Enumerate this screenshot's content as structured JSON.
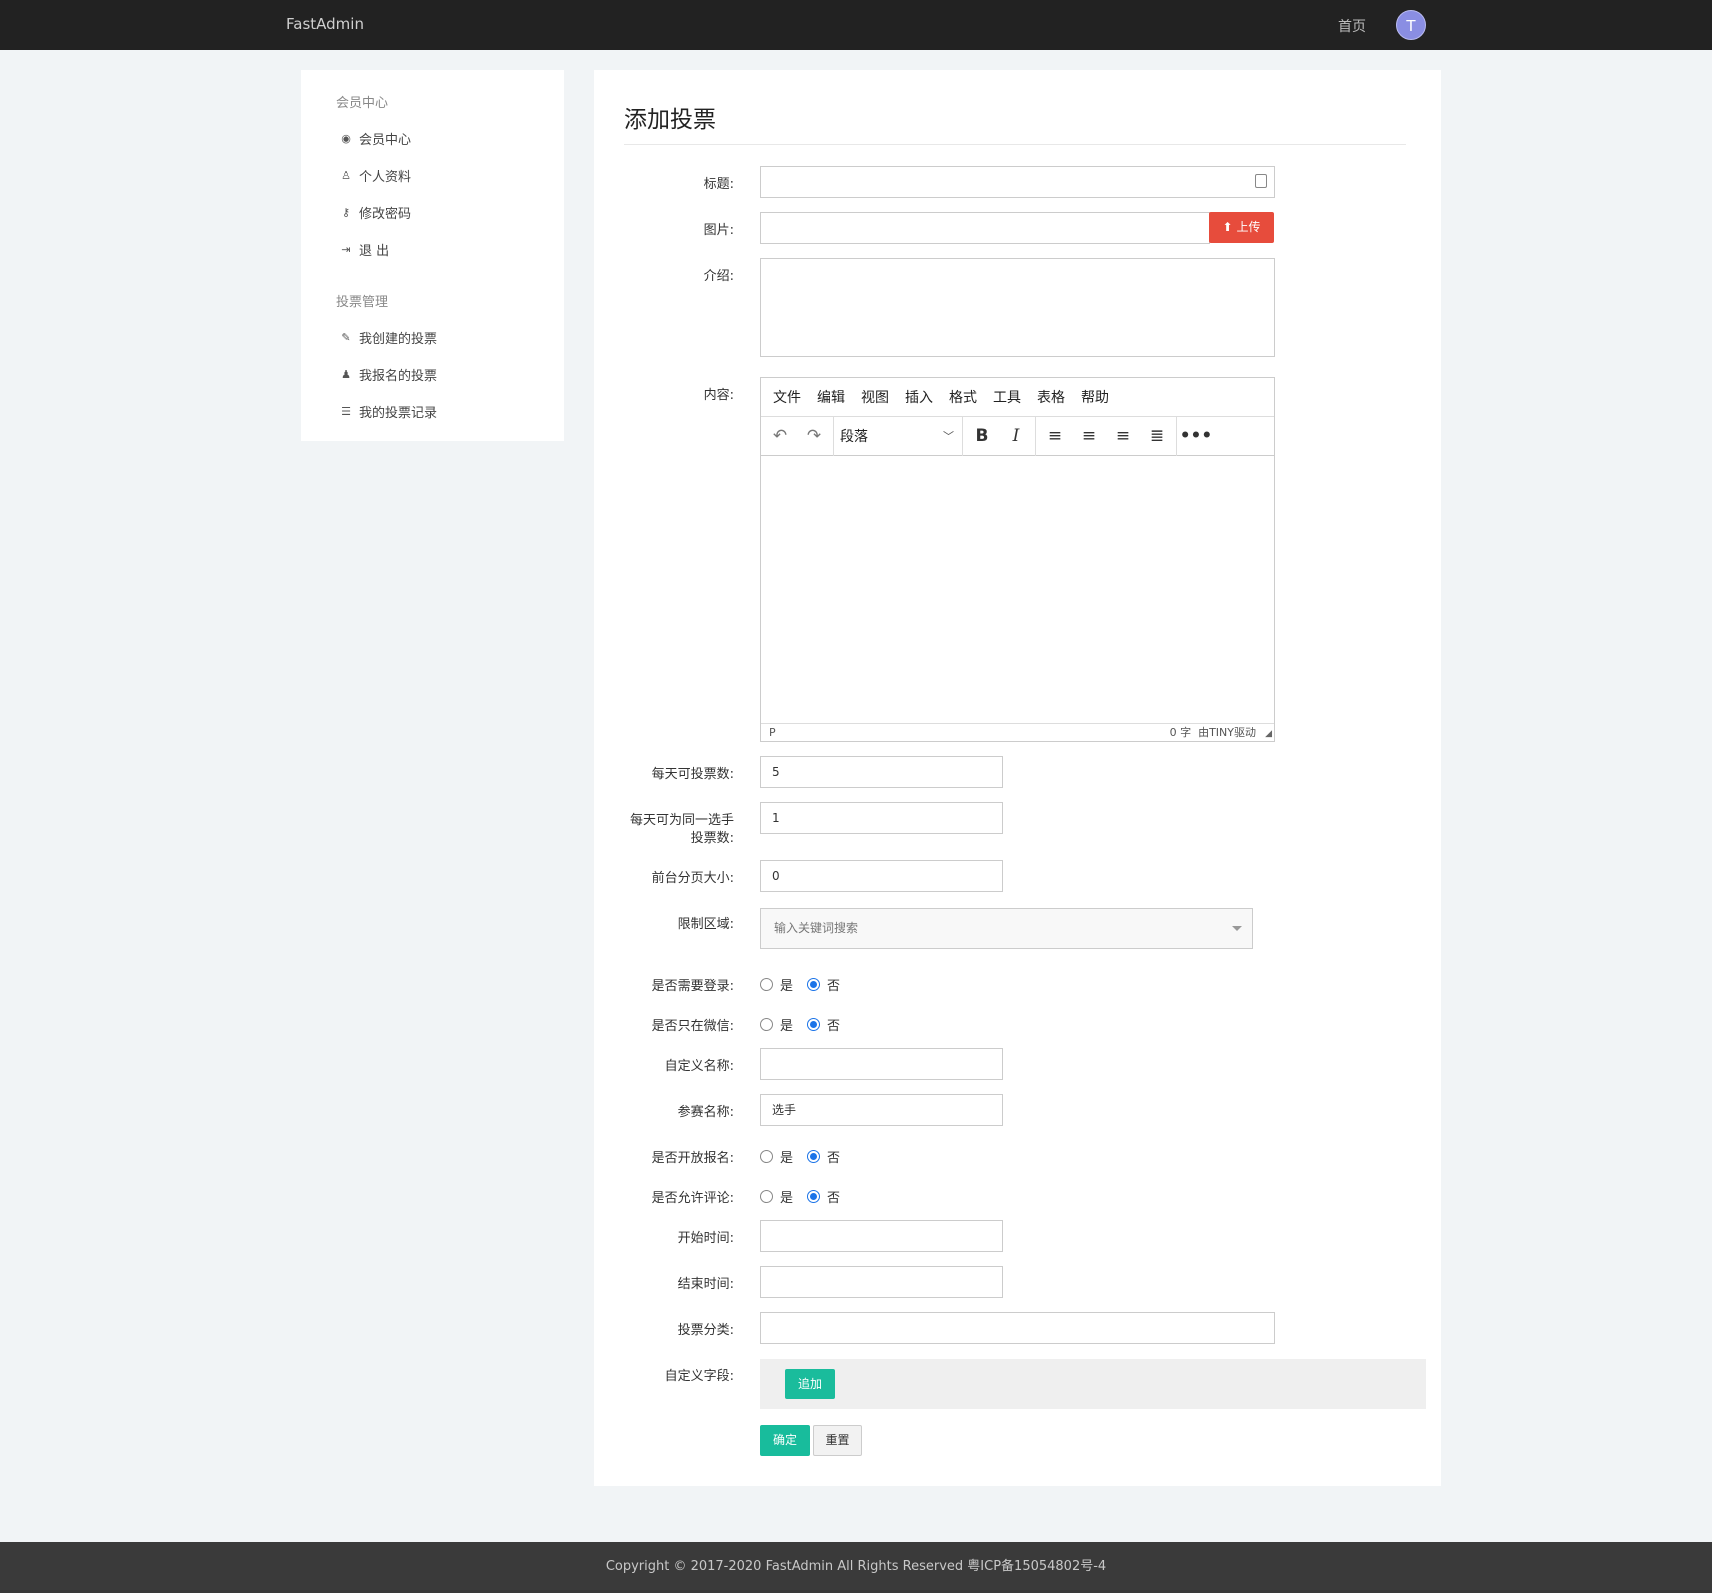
{
  "topbar": {
    "brand": "FastAdmin",
    "home_link": "首页",
    "avatar_letter": "T"
  },
  "sidebar": {
    "section1_title": "会员中心",
    "section1_items": [
      {
        "icon": "user-circle-icon",
        "glyph": "◉",
        "label": "会员中心"
      },
      {
        "icon": "user-icon",
        "glyph": "♙",
        "label": "个人资料"
      },
      {
        "icon": "key-icon",
        "glyph": "⚷",
        "label": "修改密码"
      },
      {
        "icon": "sign-out-icon",
        "glyph": "⇥",
        "label": "退 出"
      }
    ],
    "section2_title": "投票管理",
    "section2_items": [
      {
        "icon": "pencil-icon",
        "glyph": "✎",
        "label": "我创建的投票"
      },
      {
        "icon": "users-icon",
        "glyph": "♟",
        "label": "我报名的投票"
      },
      {
        "icon": "list-icon",
        "glyph": "☰",
        "label": "我的投票记录"
      }
    ]
  },
  "form": {
    "page_title": "添加投票",
    "labels": {
      "title": "标题:",
      "image": "图片:",
      "intro": "介绍:",
      "content": "内容:",
      "daily_votes": "每天可投票数:",
      "daily_same_line1": "每天可为同一选手",
      "daily_same_line2": "投票数:",
      "page_size": "前台分页大小:",
      "region": "限制区域:",
      "need_login": "是否需要登录:",
      "wechat_only": "是否只在微信:",
      "custom_name": "自定义名称:",
      "contestant_name": "参赛名称:",
      "open_signup": "是否开放报名:",
      "allow_comment": "是否允许评论:",
      "start_time": "开始时间:",
      "end_time": "结束时间:",
      "category": "投票分类:",
      "custom_fields": "自定义字段:"
    },
    "values": {
      "title": "",
      "image": "",
      "daily_votes": "5",
      "daily_same": "1",
      "page_size": "0",
      "custom_name": "",
      "contestant_name": "选手",
      "start_time": "",
      "end_time": "",
      "category": ""
    },
    "region_placeholder": "输入关键词搜索",
    "upload_label": "上传",
    "radio_yes": "是",
    "radio_no": "否",
    "add_label": "追加",
    "submit_label": "确定",
    "reset_label": "重置"
  },
  "editor": {
    "menus": [
      "文件",
      "编辑",
      "视图",
      "插入",
      "格式",
      "工具",
      "表格",
      "帮助"
    ],
    "block_format": "段落",
    "path": "P",
    "word_count": "0 字",
    "powered": "由TINY驱动"
  },
  "footer": {
    "copyright": "Copyright © 2017-2020 FastAdmin All Rights Reserved 粤ICP备15054802号-4"
  }
}
